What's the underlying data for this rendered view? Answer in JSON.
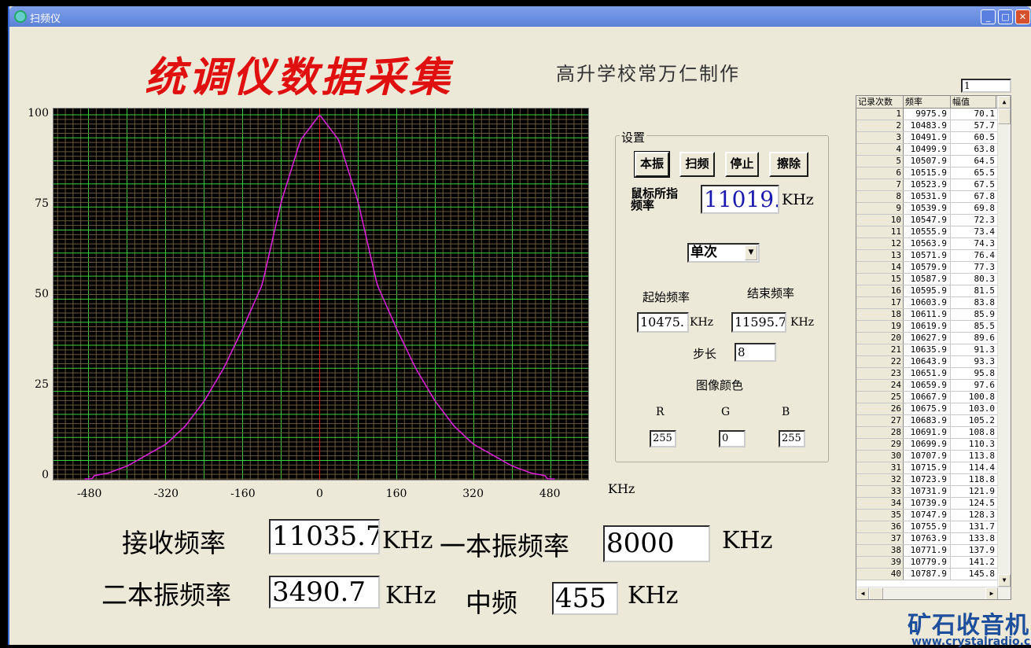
{
  "window": {
    "title": "扫频仪"
  },
  "header": {
    "title": "统调仪数据采集",
    "subtitle": "高升学校常万仁制作"
  },
  "chart_data": {
    "type": "line",
    "xlabel": "KHz",
    "ylabel": "",
    "xlim": [
      -555,
      560
    ],
    "ylim": [
      0,
      100
    ],
    "x_ticks": [
      "-480",
      "-320",
      "-160",
      "0",
      "160",
      "320",
      "480"
    ],
    "y_ticks": [
      "0",
      "25",
      "50",
      "75",
      "100"
    ],
    "grid": true,
    "marker_x": 0,
    "series": [
      {
        "name": "amplitude",
        "color": "#e020e0",
        "x": [
          -480,
          -440,
          -400,
          -360,
          -320,
          -280,
          -240,
          -200,
          -160,
          -120,
          -80,
          -40,
          0,
          40,
          80,
          120,
          160,
          200,
          240,
          280,
          320,
          360,
          400,
          440,
          480
        ],
        "y": [
          0,
          1,
          3,
          6,
          9,
          14,
          21,
          30,
          41,
          53,
          76,
          93,
          100,
          93,
          76,
          53,
          41,
          30,
          21,
          14,
          9,
          6,
          3,
          1,
          0
        ]
      }
    ],
    "colors": {
      "background": "#000000",
      "grid_major": "#40d040",
      "grid_minor": "#6a5a3a",
      "marker": "#e01010"
    }
  },
  "bottom": {
    "recv_label": "接收频率",
    "recv_value": "11035.7",
    "recv_unit": "KHz",
    "lo1_label": "一本振频率",
    "lo1_value": "8000",
    "lo1_unit": "KHz",
    "lo2_label": "二本振频率",
    "lo2_value": "3490.7",
    "lo2_unit": "KHz",
    "if_label": "中频",
    "if_value": "455",
    "if_unit": "KHz"
  },
  "settings": {
    "group_label": "设置",
    "buttons": [
      "本振",
      "扫频",
      "停止",
      "擦除"
    ],
    "cursor_label_1": "鼠标所指",
    "cursor_label_2": "频率",
    "cursor_value": "11019.",
    "cursor_unit": "KHz",
    "mode": "单次",
    "start_label": "起始频率",
    "start_value": "10475.",
    "start_unit": "KHz",
    "end_label": "结束频率",
    "end_value": "11595.7",
    "end_unit": "KHz",
    "step_label": "步长",
    "step_value": "8",
    "color_label": "图像颜色",
    "r_label": "R",
    "g_label": "G",
    "b_label": "B",
    "r_value": "255",
    "g_value": "0",
    "b_value": "255"
  },
  "table": {
    "record_input": "1",
    "headers": [
      "记录次数",
      "频率",
      "幅值"
    ],
    "rows": [
      [
        "1",
        "9975.9",
        "70.1"
      ],
      [
        "2",
        "10483.9",
        "57.7"
      ],
      [
        "3",
        "10491.9",
        "60.5"
      ],
      [
        "4",
        "10499.9",
        "63.8"
      ],
      [
        "5",
        "10507.9",
        "64.5"
      ],
      [
        "6",
        "10515.9",
        "65.5"
      ],
      [
        "7",
        "10523.9",
        "67.5"
      ],
      [
        "8",
        "10531.9",
        "67.8"
      ],
      [
        "9",
        "10539.9",
        "69.8"
      ],
      [
        "10",
        "10547.9",
        "72.3"
      ],
      [
        "11",
        "10555.9",
        "73.4"
      ],
      [
        "12",
        "10563.9",
        "74.3"
      ],
      [
        "13",
        "10571.9",
        "76.4"
      ],
      [
        "14",
        "10579.9",
        "77.3"
      ],
      [
        "15",
        "10587.9",
        "80.3"
      ],
      [
        "16",
        "10595.9",
        "81.5"
      ],
      [
        "17",
        "10603.9",
        "83.8"
      ],
      [
        "18",
        "10611.9",
        "85.9"
      ],
      [
        "19",
        "10619.9",
        "85.5"
      ],
      [
        "20",
        "10627.9",
        "89.6"
      ],
      [
        "21",
        "10635.9",
        "91.3"
      ],
      [
        "22",
        "10643.9",
        "93.3"
      ],
      [
        "23",
        "10651.9",
        "95.8"
      ],
      [
        "24",
        "10659.9",
        "97.6"
      ],
      [
        "25",
        "10667.9",
        "100.8"
      ],
      [
        "26",
        "10675.9",
        "103.0"
      ],
      [
        "27",
        "10683.9",
        "105.2"
      ],
      [
        "28",
        "10691.9",
        "108.8"
      ],
      [
        "29",
        "10699.9",
        "110.3"
      ],
      [
        "30",
        "10707.9",
        "113.8"
      ],
      [
        "31",
        "10715.9",
        "114.4"
      ],
      [
        "32",
        "10723.9",
        "118.8"
      ],
      [
        "33",
        "10731.9",
        "121.9"
      ],
      [
        "34",
        "10739.9",
        "124.5"
      ],
      [
        "35",
        "10747.9",
        "128.3"
      ],
      [
        "36",
        "10755.9",
        "131.7"
      ],
      [
        "37",
        "10763.9",
        "133.8"
      ],
      [
        "38",
        "10771.9",
        "137.9"
      ],
      [
        "39",
        "10779.9",
        "141.2"
      ],
      [
        "40",
        "10787.9",
        "145.8"
      ]
    ]
  },
  "watermark": {
    "text": "矿石收音机",
    "url": "www.crystalradio.cn"
  }
}
